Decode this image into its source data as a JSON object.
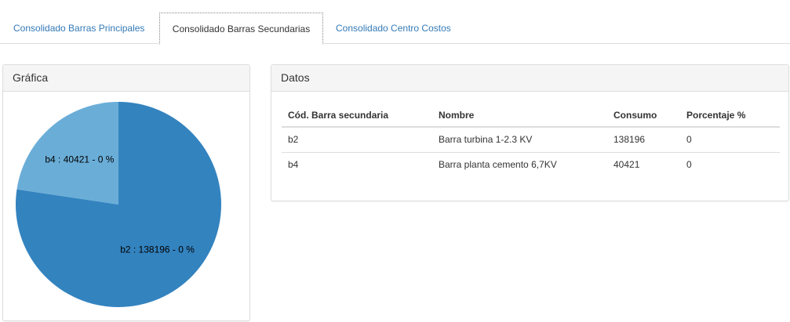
{
  "tabs": [
    {
      "label": "Consolidado Barras Principales"
    },
    {
      "label": "Consolidado Barras Secundarias",
      "active": true
    },
    {
      "label": "Consolidado Centro Costos"
    }
  ],
  "chart_panel": {
    "title": "Gráfica"
  },
  "data_panel": {
    "title": "Datos"
  },
  "table": {
    "headers": [
      "Cód. Barra secundaria",
      "Nombre",
      "Consumo",
      "Porcentaje %"
    ],
    "rows": [
      [
        "b2",
        "Barra turbina 1-2.3 KV",
        "138196",
        "0"
      ],
      [
        "b4",
        "Barra planta cemento 6,7KV",
        "40421",
        "0"
      ]
    ]
  },
  "chart_data": {
    "type": "pie",
    "slices": [
      {
        "label": "b2 : 138196 - 0 %",
        "category": "b2",
        "value": 138196,
        "color": "#3383bf"
      },
      {
        "label": "b4 : 40421 - 0 %",
        "category": "b4",
        "value": 40421,
        "color": "#6aaed8"
      }
    ],
    "title": ""
  },
  "colors": {
    "link": "#337ab7",
    "border": "#dddddd",
    "heading_bg": "#f5f5f5"
  }
}
